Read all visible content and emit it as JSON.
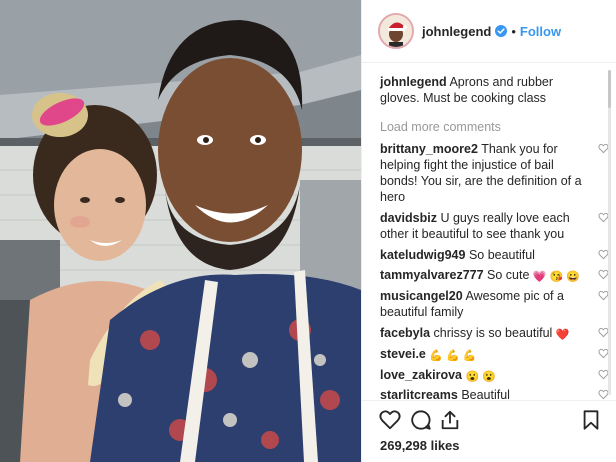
{
  "post": {
    "username": "johnlegend",
    "follow_label": "Follow",
    "separator": "•",
    "caption_user": "johnlegend",
    "caption_text": "Aprons and rubber gloves. Must be cooking class",
    "load_more": "Load more comments",
    "likes": "269,298 likes"
  },
  "comments": [
    {
      "user": "brittany_moore2",
      "text": "Thank you for helping fight the injustice of bail bonds! You sir, are the definition of a hero",
      "emoji": ""
    },
    {
      "user": "davidsbiz",
      "text": "U guys really love each other it beautiful to see thank you",
      "emoji": ""
    },
    {
      "user": "kateludwig949",
      "text": "So beautiful",
      "emoji": ""
    },
    {
      "user": "tammyalvarez777",
      "text": "So cute",
      "emoji": "💗 😘 😀"
    },
    {
      "user": "musicangel20",
      "text": "Awesome pic of a beautiful family",
      "emoji": ""
    },
    {
      "user": "facebyla",
      "text": "chrissy is so beautiful",
      "emoji": "❤️"
    },
    {
      "user": "stevei.e",
      "text": "",
      "emoji": "💪 💪 💪"
    },
    {
      "user": "love_zakirova",
      "text": "",
      "emoji": "😮 😮"
    },
    {
      "user": "starlitcreams",
      "text": "Beautiful",
      "emoji": ""
    }
  ],
  "icons": {
    "verified": "verified-badge-icon",
    "heart": "heart-outline-icon",
    "comment": "comment-bubble-icon",
    "share": "share-icon",
    "save": "bookmark-icon"
  },
  "colors": {
    "link_blue": "#3897f0",
    "muted_gray": "#999999",
    "border": "#efefef"
  }
}
